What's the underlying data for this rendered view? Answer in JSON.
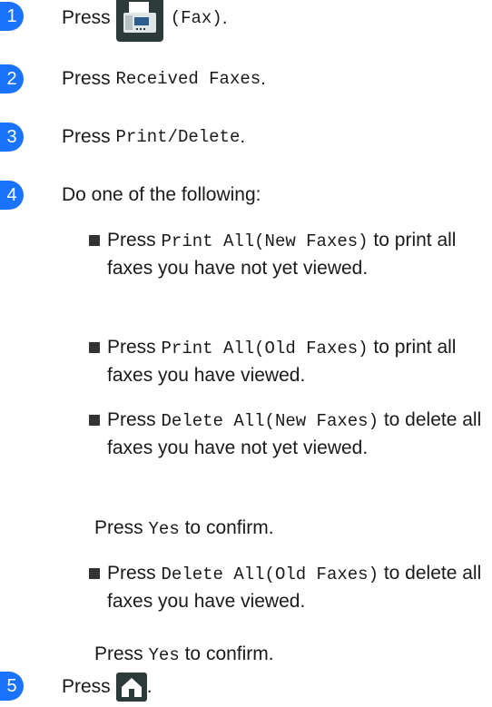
{
  "steps": {
    "s1": {
      "num": "1",
      "press": "Press",
      "code": "(Fax)",
      "suffix": ".",
      "icon": "fax-icon"
    },
    "s2": {
      "num": "2",
      "press": "Press",
      "code": "Received Faxes",
      "suffix": "."
    },
    "s3": {
      "num": "3",
      "press": "Press",
      "code": "Print/Delete",
      "suffix": "."
    },
    "s4": {
      "num": "4",
      "text": "Do one of the following:"
    },
    "s5": {
      "num": "5",
      "press": "Press",
      "suffix": ".",
      "icon": "home-icon"
    }
  },
  "options": [
    {
      "press": "Press",
      "code": "Print All(New Faxes)",
      "text": "to print all faxes you have not yet viewed."
    },
    {
      "press": "Press",
      "code": "Print All(Old Faxes)",
      "text": "to print all faxes you have viewed."
    },
    {
      "press": "Press",
      "code": "Delete All(New Faxes)",
      "text": "to delete all faxes you have not yet viewed."
    },
    {
      "press": "Press",
      "code": "Delete All(Old Faxes)",
      "text": "to delete all faxes you have viewed."
    }
  ],
  "confirm": {
    "press": "Press",
    "code": "Yes",
    "text": "to confirm."
  },
  "colors": {
    "step_badge": "#1a73ff",
    "icon_bg": "#2d3a3a"
  }
}
